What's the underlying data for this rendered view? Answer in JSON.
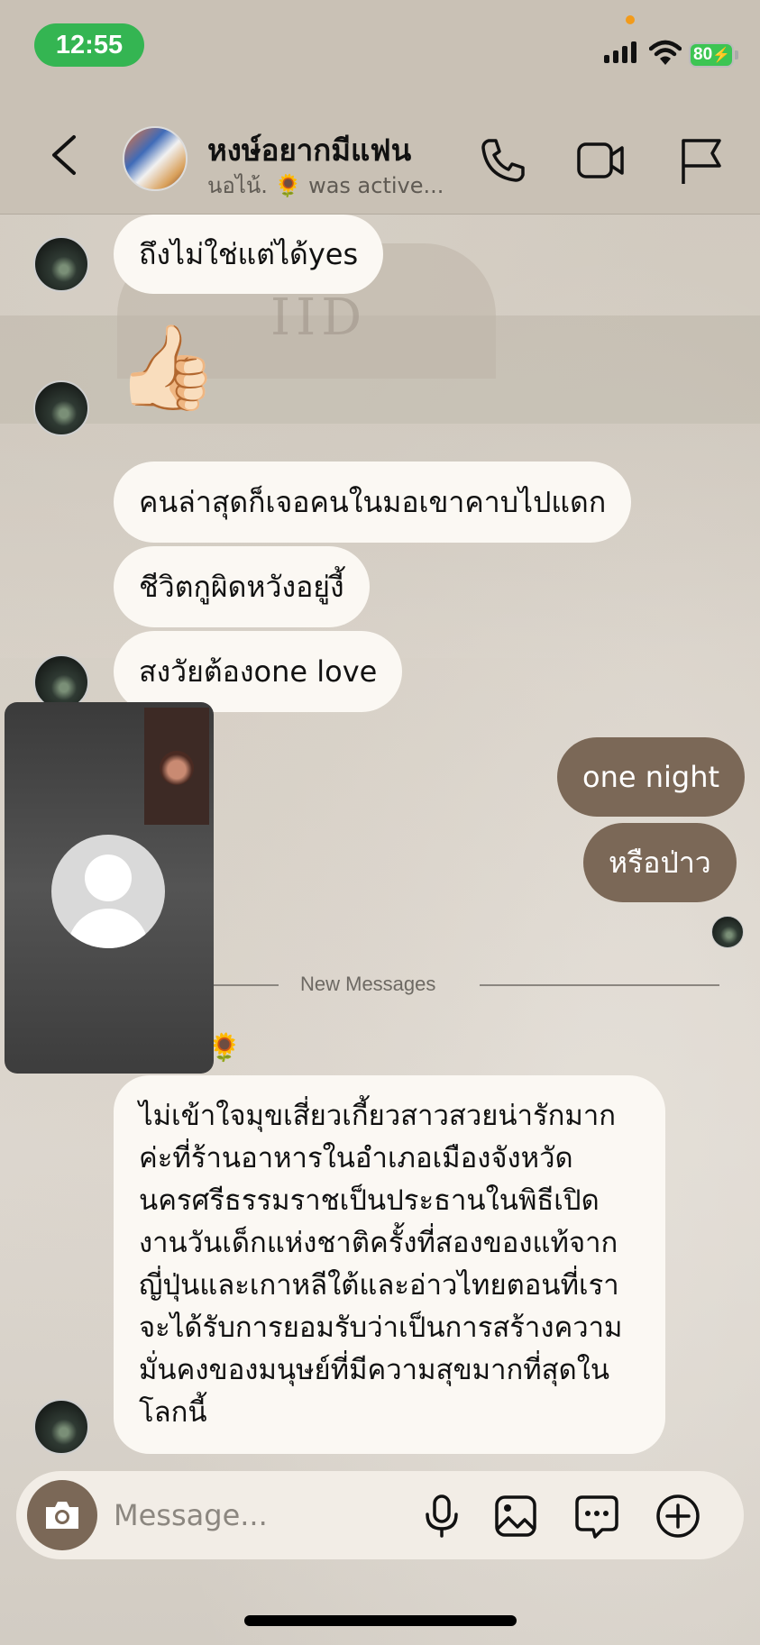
{
  "status_bar": {
    "time": "12:55",
    "battery": "80"
  },
  "header": {
    "title": "หงษ์อยากมีแฟน",
    "subtitle": "นอไน้. 🌻 was active..."
  },
  "messages": {
    "m1": "ถึงไม่ใช่แต่ได้yes",
    "thumbs": "👍🏻",
    "m2": "คนล่าสุดก็เจอคนในมอเขาคาบไปแดก",
    "m3": "ชีวิตกูผิดหวังอยู่งี้",
    "m4": "สงวัยต้องone love",
    "me1": "one night",
    "me2": "หรือป่าว",
    "divider": "New Messages",
    "sunflower": "🌻",
    "long": "ไม่เข้าใจมุขเสี่ยวเกี้ยวสาวสวยน่ารักมากค่ะที่ร้านอาหารในอำเภอเมืองจังหวัดนครศรีธรรมราชเป็นประธานในพิธีเปิดงานวันเด็กแห่งชาติครั้งที่สองของแท้จากญี่ปุ่นและเกาหลีใต้และอ่าวไทยตอนที่เราจะได้รับการยอมรับว่าเป็นการสร้างความมั่นคงของมนุษย์ที่มีความสุขมากที่สุดในโลกนี้"
  },
  "composer": {
    "placeholder": "Message..."
  },
  "colors": {
    "accent": "#7b6857",
    "bubble_incoming": "#fbf8f3",
    "time_pill": "#34b552"
  }
}
